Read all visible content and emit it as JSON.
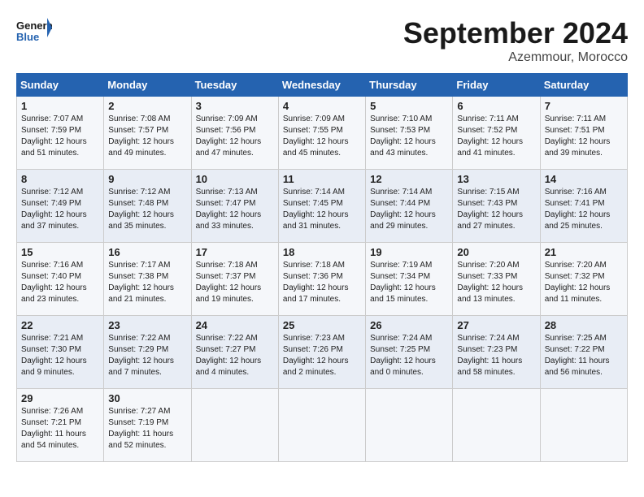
{
  "header": {
    "logo_text_general": "General",
    "logo_text_blue": "Blue",
    "month": "September 2024",
    "location": "Azemmour, Morocco"
  },
  "weekdays": [
    "Sunday",
    "Monday",
    "Tuesday",
    "Wednesday",
    "Thursday",
    "Friday",
    "Saturday"
  ],
  "weeks": [
    [
      {
        "day": "1",
        "lines": [
          "Sunrise: 7:07 AM",
          "Sunset: 7:59 PM",
          "Daylight: 12 hours",
          "and 51 minutes."
        ]
      },
      {
        "day": "2",
        "lines": [
          "Sunrise: 7:08 AM",
          "Sunset: 7:57 PM",
          "Daylight: 12 hours",
          "and 49 minutes."
        ]
      },
      {
        "day": "3",
        "lines": [
          "Sunrise: 7:09 AM",
          "Sunset: 7:56 PM",
          "Daylight: 12 hours",
          "and 47 minutes."
        ]
      },
      {
        "day": "4",
        "lines": [
          "Sunrise: 7:09 AM",
          "Sunset: 7:55 PM",
          "Daylight: 12 hours",
          "and 45 minutes."
        ]
      },
      {
        "day": "5",
        "lines": [
          "Sunrise: 7:10 AM",
          "Sunset: 7:53 PM",
          "Daylight: 12 hours",
          "and 43 minutes."
        ]
      },
      {
        "day": "6",
        "lines": [
          "Sunrise: 7:11 AM",
          "Sunset: 7:52 PM",
          "Daylight: 12 hours",
          "and 41 minutes."
        ]
      },
      {
        "day": "7",
        "lines": [
          "Sunrise: 7:11 AM",
          "Sunset: 7:51 PM",
          "Daylight: 12 hours",
          "and 39 minutes."
        ]
      }
    ],
    [
      {
        "day": "8",
        "lines": [
          "Sunrise: 7:12 AM",
          "Sunset: 7:49 PM",
          "Daylight: 12 hours",
          "and 37 minutes."
        ]
      },
      {
        "day": "9",
        "lines": [
          "Sunrise: 7:12 AM",
          "Sunset: 7:48 PM",
          "Daylight: 12 hours",
          "and 35 minutes."
        ]
      },
      {
        "day": "10",
        "lines": [
          "Sunrise: 7:13 AM",
          "Sunset: 7:47 PM",
          "Daylight: 12 hours",
          "and 33 minutes."
        ]
      },
      {
        "day": "11",
        "lines": [
          "Sunrise: 7:14 AM",
          "Sunset: 7:45 PM",
          "Daylight: 12 hours",
          "and 31 minutes."
        ]
      },
      {
        "day": "12",
        "lines": [
          "Sunrise: 7:14 AM",
          "Sunset: 7:44 PM",
          "Daylight: 12 hours",
          "and 29 minutes."
        ]
      },
      {
        "day": "13",
        "lines": [
          "Sunrise: 7:15 AM",
          "Sunset: 7:43 PM",
          "Daylight: 12 hours",
          "and 27 minutes."
        ]
      },
      {
        "day": "14",
        "lines": [
          "Sunrise: 7:16 AM",
          "Sunset: 7:41 PM",
          "Daylight: 12 hours",
          "and 25 minutes."
        ]
      }
    ],
    [
      {
        "day": "15",
        "lines": [
          "Sunrise: 7:16 AM",
          "Sunset: 7:40 PM",
          "Daylight: 12 hours",
          "and 23 minutes."
        ]
      },
      {
        "day": "16",
        "lines": [
          "Sunrise: 7:17 AM",
          "Sunset: 7:38 PM",
          "Daylight: 12 hours",
          "and 21 minutes."
        ]
      },
      {
        "day": "17",
        "lines": [
          "Sunrise: 7:18 AM",
          "Sunset: 7:37 PM",
          "Daylight: 12 hours",
          "and 19 minutes."
        ]
      },
      {
        "day": "18",
        "lines": [
          "Sunrise: 7:18 AM",
          "Sunset: 7:36 PM",
          "Daylight: 12 hours",
          "and 17 minutes."
        ]
      },
      {
        "day": "19",
        "lines": [
          "Sunrise: 7:19 AM",
          "Sunset: 7:34 PM",
          "Daylight: 12 hours",
          "and 15 minutes."
        ]
      },
      {
        "day": "20",
        "lines": [
          "Sunrise: 7:20 AM",
          "Sunset: 7:33 PM",
          "Daylight: 12 hours",
          "and 13 minutes."
        ]
      },
      {
        "day": "21",
        "lines": [
          "Sunrise: 7:20 AM",
          "Sunset: 7:32 PM",
          "Daylight: 12 hours",
          "and 11 minutes."
        ]
      }
    ],
    [
      {
        "day": "22",
        "lines": [
          "Sunrise: 7:21 AM",
          "Sunset: 7:30 PM",
          "Daylight: 12 hours",
          "and 9 minutes."
        ]
      },
      {
        "day": "23",
        "lines": [
          "Sunrise: 7:22 AM",
          "Sunset: 7:29 PM",
          "Daylight: 12 hours",
          "and 7 minutes."
        ]
      },
      {
        "day": "24",
        "lines": [
          "Sunrise: 7:22 AM",
          "Sunset: 7:27 PM",
          "Daylight: 12 hours",
          "and 4 minutes."
        ]
      },
      {
        "day": "25",
        "lines": [
          "Sunrise: 7:23 AM",
          "Sunset: 7:26 PM",
          "Daylight: 12 hours",
          "and 2 minutes."
        ]
      },
      {
        "day": "26",
        "lines": [
          "Sunrise: 7:24 AM",
          "Sunset: 7:25 PM",
          "Daylight: 12 hours",
          "and 0 minutes."
        ]
      },
      {
        "day": "27",
        "lines": [
          "Sunrise: 7:24 AM",
          "Sunset: 7:23 PM",
          "Daylight: 11 hours",
          "and 58 minutes."
        ]
      },
      {
        "day": "28",
        "lines": [
          "Sunrise: 7:25 AM",
          "Sunset: 7:22 PM",
          "Daylight: 11 hours",
          "and 56 minutes."
        ]
      }
    ],
    [
      {
        "day": "29",
        "lines": [
          "Sunrise: 7:26 AM",
          "Sunset: 7:21 PM",
          "Daylight: 11 hours",
          "and 54 minutes."
        ]
      },
      {
        "day": "30",
        "lines": [
          "Sunrise: 7:27 AM",
          "Sunset: 7:19 PM",
          "Daylight: 11 hours",
          "and 52 minutes."
        ]
      },
      null,
      null,
      null,
      null,
      null
    ]
  ]
}
